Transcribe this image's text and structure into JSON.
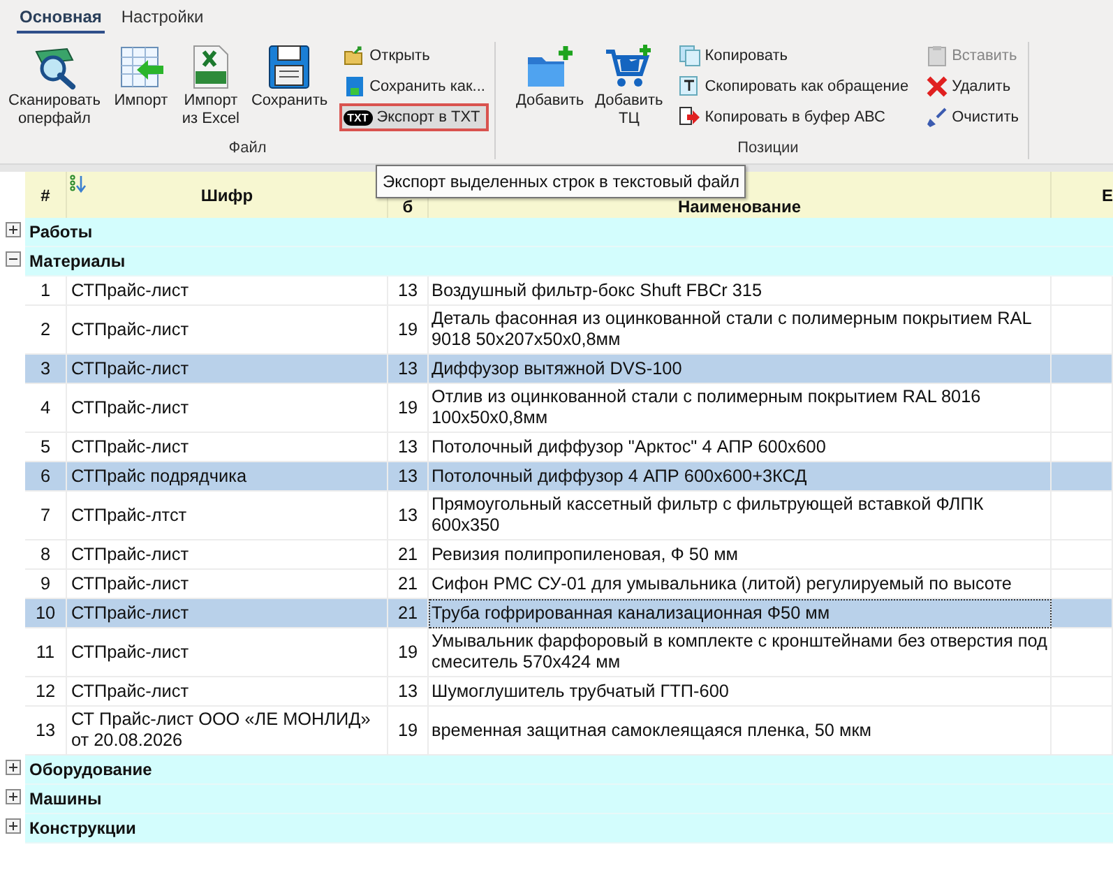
{
  "ribbon": {
    "tabs": [
      {
        "label": "Основная",
        "selected": true
      },
      {
        "label": "Настройки",
        "selected": false
      }
    ],
    "groups": [
      {
        "label": "Файл",
        "large_buttons": [
          {
            "kind": "scan",
            "label": "Сканировать\nоперфайл"
          },
          {
            "kind": "import",
            "label": "Импорт"
          },
          {
            "kind": "excel",
            "label": "Импорт\nиз Excel"
          },
          {
            "kind": "save",
            "label": "Сохранить"
          }
        ],
        "small_buttons": [
          [
            {
              "kind": "open",
              "label": "Открыть",
              "highlighted": false,
              "disabled": false
            },
            {
              "kind": "saveas",
              "label": "Сохранить как...",
              "highlighted": false,
              "disabled": false
            },
            {
              "kind": "txt",
              "badge": "TXT",
              "label": "Экспорт в ТХТ",
              "highlighted": true,
              "disabled": false
            }
          ]
        ]
      },
      {
        "label": "Позиции",
        "large_buttons": [
          {
            "kind": "folder-add",
            "label": "Добавить"
          },
          {
            "kind": "cart-add",
            "label": "Добавить\nТЦ"
          }
        ],
        "small_buttons": [
          [
            {
              "kind": "copy",
              "label": "Копировать",
              "highlighted": false,
              "disabled": false
            },
            {
              "kind": "copy-ref",
              "label": "Скопировать как обращение",
              "highlighted": false,
              "disabled": false
            },
            {
              "kind": "copy-abc",
              "label": "Копировать в буфер АВС",
              "highlighted": false,
              "disabled": false
            }
          ],
          [
            {
              "kind": "paste",
              "label": "Вставить",
              "highlighted": false,
              "disabled": true
            },
            {
              "kind": "delete",
              "label": "Удалить",
              "highlighted": false,
              "disabled": false
            },
            {
              "kind": "clear",
              "label": "Очистить",
              "highlighted": false,
              "disabled": false
            }
          ]
        ]
      }
    ]
  },
  "tooltip": {
    "text": "Экспорт выделенных строк в текстовый файл"
  },
  "table": {
    "columns": [
      {
        "label": "#"
      },
      {
        "label": "Шифр"
      },
      {
        "label": "б"
      },
      {
        "label": "Наименование"
      },
      {
        "label": "Е"
      }
    ],
    "groups": [
      {
        "title": "Работы",
        "expanded": false
      },
      {
        "title": "Материалы",
        "expanded": true,
        "rows": [
          {
            "num": "1",
            "code": "СТПрайс-лист",
            "column_3": "13",
            "name": "Воздушный фильтр-бокс Shuft  FBCr 315",
            "selected": false,
            "focused": false
          },
          {
            "num": "2",
            "code": "СТПрайс-лист",
            "column_3": "19",
            "name": "Деталь фасонная из оцинкованной стали с полимерным покрытием RAL 9018 50х207х50х0,8мм",
            "selected": false,
            "focused": false
          },
          {
            "num": "3",
            "code": "СТПрайс-лист",
            "column_3": "13",
            "name": "Диффузор вытяжной DVS-100",
            "selected": true,
            "focused": false
          },
          {
            "num": "4",
            "code": "СТПрайс-лист",
            "column_3": "19",
            "name": "Отлив из оцинкованной стали с полимерным покрытием RAL 8016 100х50х0,8мм",
            "selected": false,
            "focused": false
          },
          {
            "num": "5",
            "code": "СТПрайс-лист",
            "column_3": "13",
            "name": "Потолочный диффузор \"Арктос\" 4 АПР 600х600",
            "selected": false,
            "focused": false
          },
          {
            "num": "6",
            "code": "СТПрайс подрядчика",
            "column_3": "13",
            "name": "Потолочный диффузор 4 АПР 600х600+3КСД",
            "selected": true,
            "focused": false
          },
          {
            "num": "7",
            "code": "СТПрайс-лтст",
            "column_3": "13",
            "name": "Прямоугольный кассетный фильтр с фильтрующей вставкой ФЛПК 600х350",
            "selected": false,
            "focused": false
          },
          {
            "num": "8",
            "code": "СТПрайс-лист",
            "column_3": "21",
            "name": "Ревизия полипропиленовая, Ф 50 мм",
            "selected": false,
            "focused": false
          },
          {
            "num": "9",
            "code": "СТПрайс-лист",
            "column_3": "21",
            "name": "Сифон РМС СУ-01 для умывальника (литой) регулируемый по высоте",
            "selected": false,
            "focused": false
          },
          {
            "num": "10",
            "code": "СТПрайс-лист",
            "column_3": "21",
            "name": "Труба гофрированная канализационная Ф50 мм",
            "selected": true,
            "focused": true
          },
          {
            "num": "11",
            "code": "СТПрайс-лист",
            "column_3": "19",
            "name": "Умывальник фарфоровый в комплекте с кронштейнами без отверстия под смеситель 570х424 мм",
            "selected": false,
            "focused": false
          },
          {
            "num": "12",
            "code": "СТПрайс-лист",
            "column_3": "13",
            "name": "Шумоглушитель трубчатый ГТП-600",
            "selected": false,
            "focused": false
          },
          {
            "num": "13",
            "code": "СТ Прайс-лист ООО «ЛЕ МОНЛИД» от 20.08.2026",
            "column_3": "19",
            "name": "временная защитная самоклеящаяся пленка, 50 мкм",
            "selected": false,
            "focused": false
          }
        ]
      },
      {
        "title": "Оборудование",
        "expanded": false
      },
      {
        "title": "Машины",
        "expanded": false
      },
      {
        "title": "Конструкции",
        "expanded": false
      }
    ]
  }
}
